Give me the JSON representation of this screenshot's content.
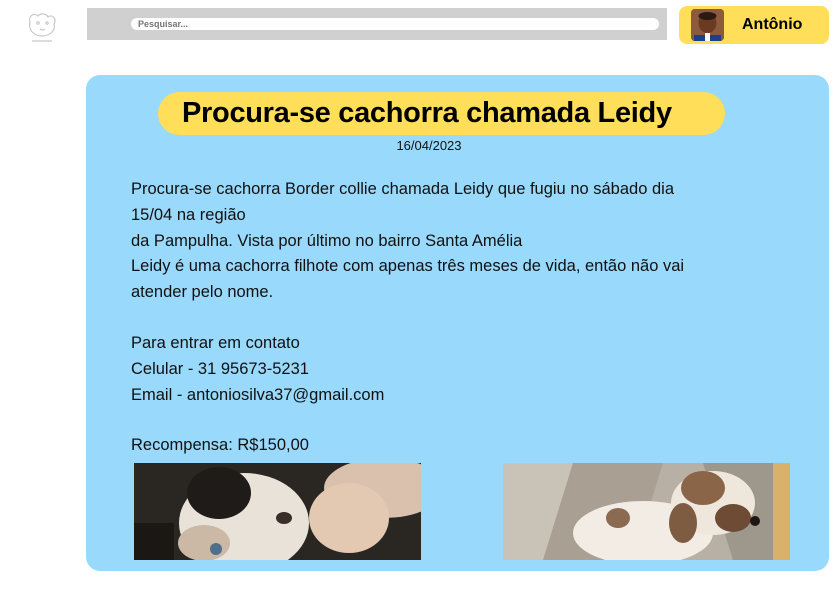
{
  "header": {
    "search": {
      "placeholder": "Pesquisar..."
    },
    "user": {
      "name": "Antônio"
    }
  },
  "post": {
    "title": "Procura-se cachorra chamada Leidy",
    "date": "16/04/2023",
    "description_lines": [
      "Procura-se cachorra Border collie chamada Leidy que fugiu no sábado dia",
      "15/04 na região",
      "da Pampulha. Vista por último no bairro Santa Amélia",
      "Leidy é uma cachorra filhote com apenas três meses de vida, então não vai",
      "atender pelo nome."
    ],
    "contact_lines": [
      "Para entrar em contato",
      "Celular - 31 95673-5231",
      "Email - antoniosilva37@gmail.com"
    ],
    "reward": "Recompensa: R$150,00"
  },
  "colors": {
    "card_background": "#99d9fb",
    "accent_yellow": "#ffde59",
    "search_bar": "#d0d0d0"
  }
}
